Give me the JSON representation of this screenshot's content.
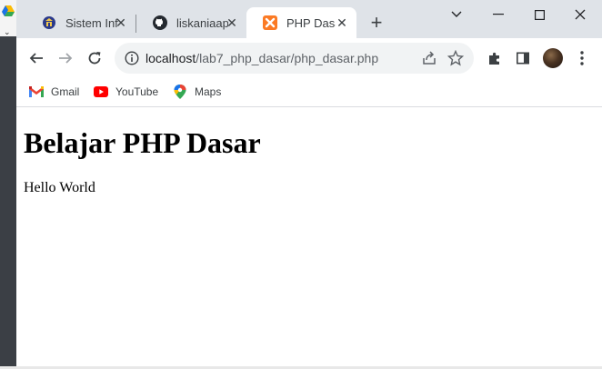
{
  "browser": {
    "tabs": [
      {
        "title": "Sistem Informasi",
        "icon": "university-logo-icon",
        "active": false
      },
      {
        "title": "liskaniaap",
        "icon": "github-icon",
        "active": false
      },
      {
        "title": "PHP Dasar",
        "icon": "xampp-icon",
        "active": true
      }
    ],
    "url_host": "localhost",
    "url_path": "/lab7_php_dasar/php_dasar.php",
    "bookmarks": [
      {
        "label": "Gmail",
        "icon": "gmail-icon"
      },
      {
        "label": "YouTube",
        "icon": "youtube-icon"
      },
      {
        "label": "Maps",
        "icon": "maps-icon"
      }
    ]
  },
  "page": {
    "heading": "Belajar PHP Dasar",
    "text": "Hello World"
  },
  "colors": {
    "tabstrip": "#dfe3e8",
    "omnibox": "#f1f3f4",
    "xampp_orange": "#fb7a24",
    "youtube_red": "#ff0000"
  }
}
